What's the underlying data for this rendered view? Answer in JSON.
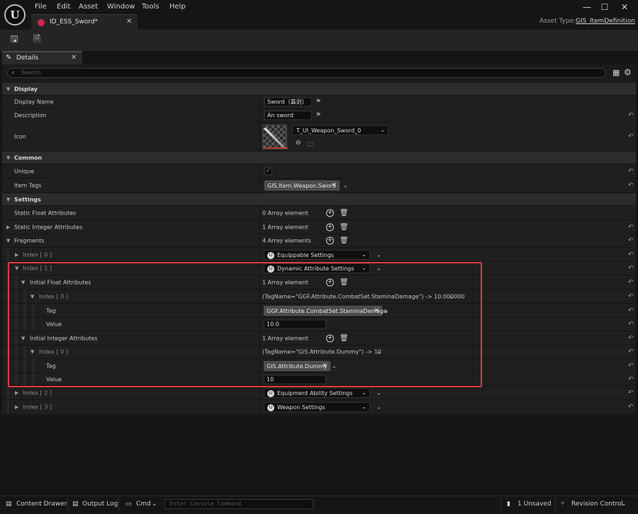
{
  "app": {
    "logo_text": "U",
    "menu": [
      "File",
      "Edit",
      "Asset",
      "Window",
      "Tools",
      "Help"
    ],
    "window_controls": {
      "minimize": "—",
      "maximize": "☐",
      "close": "✕"
    },
    "tab_title": "ID_ESS_Sword*",
    "tab_close": "✕",
    "asset_type_label": "Asset Type:",
    "asset_type_value": "GIS_ItemDefinition"
  },
  "toolbar": {
    "icons": [
      "save-icon",
      "browse-icon"
    ]
  },
  "details": {
    "tab_label": "Details",
    "tab_close": "✕",
    "search_placeholder": "Search",
    "search_icon": "⌕",
    "grid_icon": "▦",
    "gear_icon": "⚙"
  },
  "display": {
    "header": "Display",
    "display_name_label": "Display Name",
    "display_name_value": "Sword（直剑）",
    "description_label": "Description",
    "description_value": "An sword",
    "icon_label": "Icon",
    "icon_asset": "T_UI_Weapon_Sword_0"
  },
  "common": {
    "header": "Common",
    "unique_label": "Unique",
    "unique_checked": true,
    "item_tags_label": "Item Tags",
    "item_tag": "GIS.Item.Weapon.Sword"
  },
  "settings": {
    "header": "Settings",
    "static_float_label": "Static Float Attributes",
    "static_float_value": "0 Array element",
    "static_int_label": "Static Integer Attributes",
    "static_int_value": "1 Array element",
    "fragments_label": "Fragments",
    "fragments_value": "4 Array elements",
    "index0_label": "Index [ 0 ]",
    "index0_value": "Equippable Settings",
    "index1_label": "Index [ 1 ]",
    "index1_value": "Dynamic Attribute Settings",
    "init_float_label": "Initial Float Attributes",
    "init_float_value": "1 Array element",
    "float_index0_label": "Index [ 0 ]",
    "float_index0_value": "(TagName=\"GGF.Attribute.CombatSet.StaminaDamage\") -> 10.000000",
    "float_tag_label": "Tag",
    "float_tag_value": "GGF.Attribute.CombatSet.StaminaDamage",
    "float_value_label": "Value",
    "float_value_value": "10.0",
    "init_int_label": "Initial Integer Attributes",
    "init_int_value": "1 Array element",
    "int_index0_label": "Index [ 0 ]",
    "int_index0_value": "(TagName=\"GIS.Attribute.Dummy\") -> 10",
    "int_tag_label": "Tag",
    "int_tag_value": "GIS.Attribute.Dummy",
    "int_value_label": "Value",
    "int_value_value": "10",
    "index2_label": "Index [ 2 ]",
    "index2_value": "Equipment Ability Settings",
    "index3_label": "Index [ 3 ]",
    "index3_value": "Weapon Settings"
  },
  "statusbar": {
    "content_drawer": "Content Drawer",
    "output_log": "Output Log",
    "cmd": "Cmd",
    "console_placeholder": "Enter Console Command",
    "unsaved": "1 Unsaved",
    "revision_control": "Revision Control"
  },
  "colors": {
    "accent_check": "#2f8de4",
    "highlight_border": "#e03a3a",
    "tab_dot": "#d2244c"
  }
}
